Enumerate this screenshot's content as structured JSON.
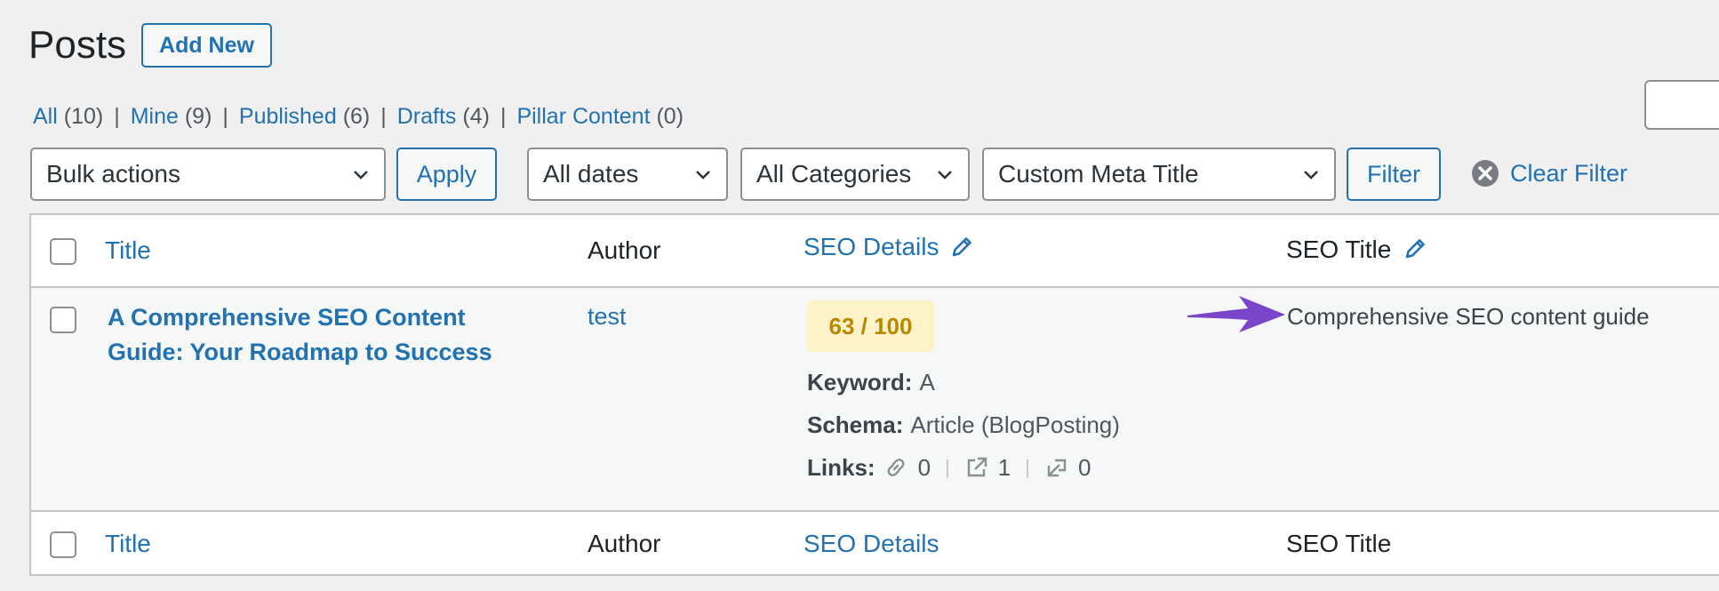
{
  "header": {
    "title": "Posts",
    "add_new_label": "Add New"
  },
  "views": [
    {
      "label": "All",
      "count": "(10)"
    },
    {
      "label": "Mine",
      "count": "(9)"
    },
    {
      "label": "Published",
      "count": "(6)"
    },
    {
      "label": "Drafts",
      "count": "(4)"
    },
    {
      "label": "Pillar Content",
      "count": "(0)"
    }
  ],
  "view_separator": "|",
  "filters": {
    "bulk_actions": "Bulk actions",
    "apply_label": "Apply",
    "dates": "All dates",
    "categories": "All Categories",
    "meta": "Custom Meta Title",
    "filter_label": "Filter",
    "clear_filter_label": "Clear Filter"
  },
  "table": {
    "columns": {
      "title": "Title",
      "author": "Author",
      "seo_details": "SEO Details",
      "seo_title": "SEO Title"
    },
    "rows": [
      {
        "title": "A Comprehensive SEO Content Guide: Your Roadmap to Success",
        "author": "test",
        "score": "63 / 100",
        "keyword_label": "Keyword:",
        "keyword_value": "A",
        "schema_label": "Schema:",
        "schema_value": "Article (BlogPosting)",
        "links_label": "Links:",
        "internal_links": "0",
        "external_links": "1",
        "incoming_links": "0",
        "seo_title": "Comprehensive SEO content guide"
      }
    ]
  },
  "colors": {
    "link": "#2271b1",
    "score_bg": "#fdf3c9",
    "score_text": "#bc8700",
    "annotation_arrow": "#7b45c9"
  },
  "icons": [
    "chevron-down-icon",
    "close-circle-icon",
    "pencil-icon",
    "link-icon",
    "external-link-icon",
    "incoming-link-icon",
    "arrow-annotation-icon"
  ]
}
